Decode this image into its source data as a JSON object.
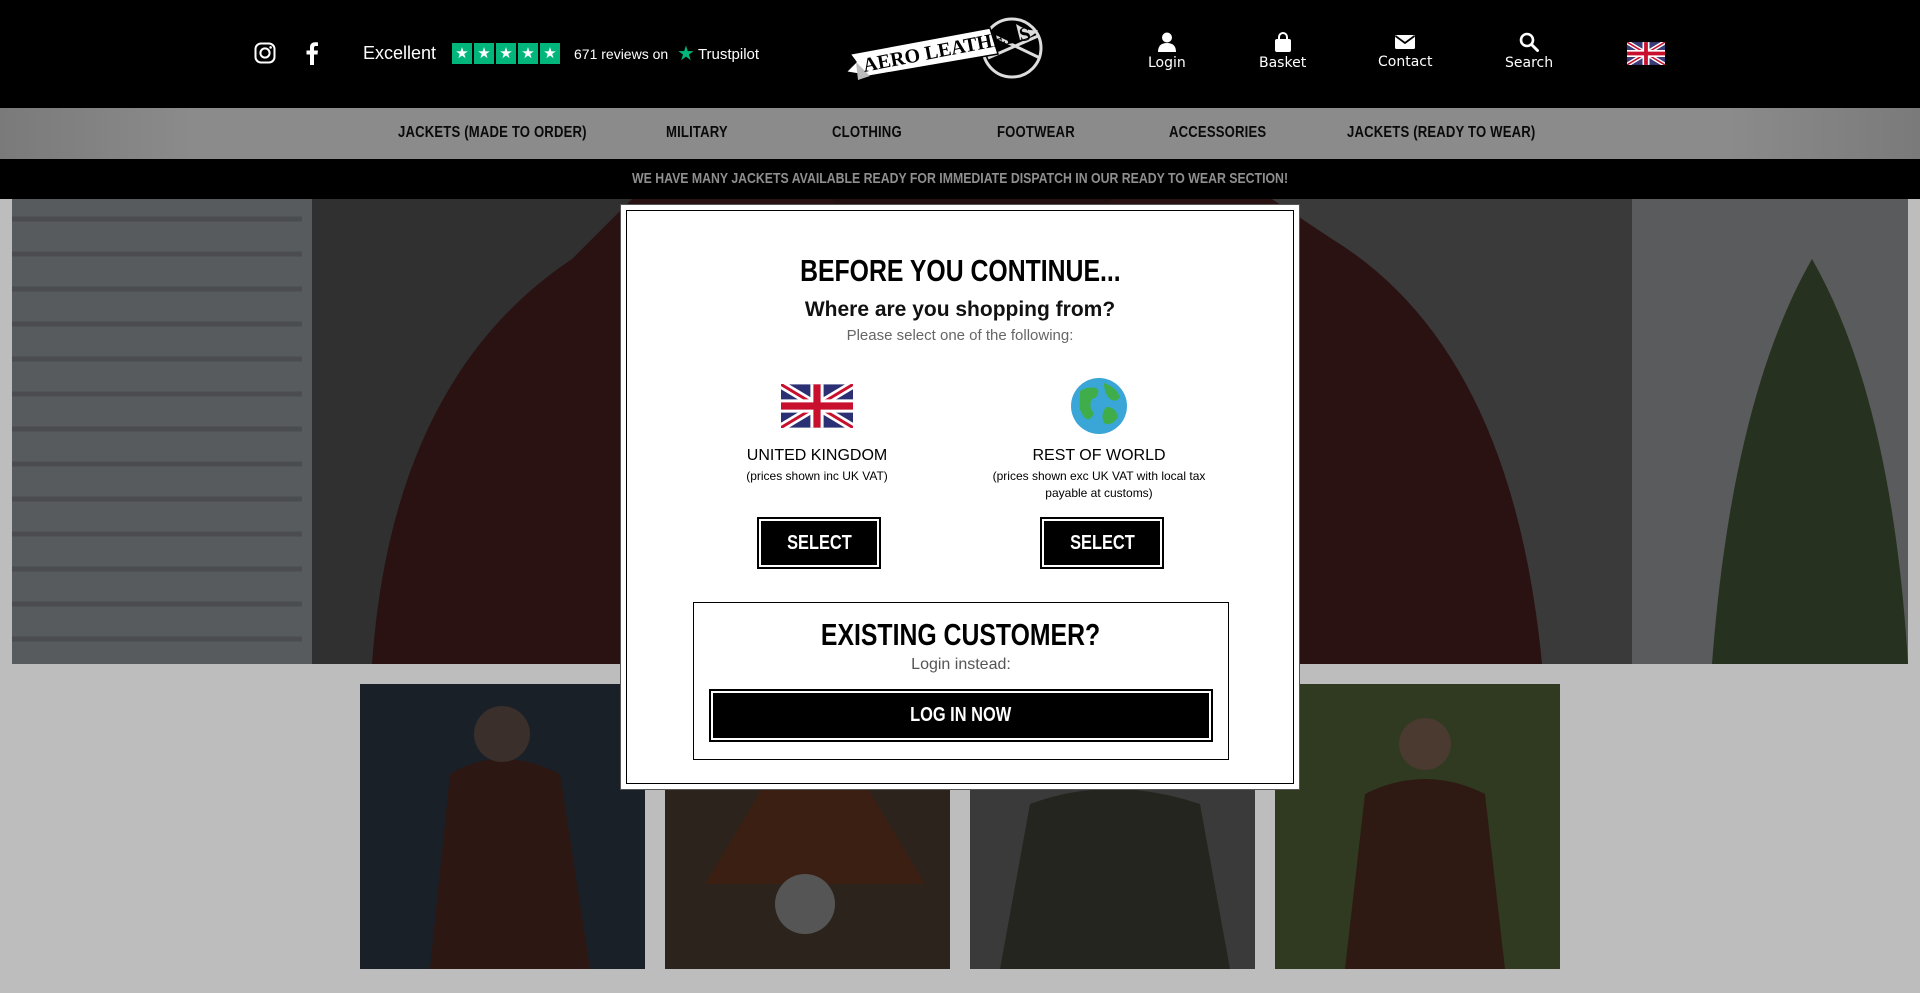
{
  "header": {
    "trustpilot": {
      "rating_label": "Excellent",
      "stars": 5,
      "reviews": "671 reviews on",
      "brand": "Trustpilot"
    },
    "logo_text": "AERO LEATHERS",
    "login_label": "Login",
    "basket_label": "Basket",
    "contact_label": "Contact",
    "search_label": "Search",
    "icons": [
      "instagram-icon",
      "facebook-icon",
      "user-icon",
      "bag-icon",
      "envelope-icon",
      "search-icon",
      "uk-flag-icon"
    ]
  },
  "nav": {
    "items": [
      "JACKETS (MADE TO ORDER)",
      "MILITARY",
      "CLOTHING",
      "FOOTWEAR",
      "ACCESSORIES",
      "JACKETS (READY TO WEAR)"
    ]
  },
  "announcement": "WE HAVE MANY JACKETS AVAILABLE READY FOR IMMEDIATE DISPATCH IN OUR READY TO WEAR SECTION!",
  "modal": {
    "title": "BEFORE YOU CONTINUE...",
    "subtitle": "Where are you shopping from?",
    "instruction": "Please select one of the following:",
    "regions": [
      {
        "name": "UNITED KINGDOM",
        "note": "(prices shown inc UK VAT)",
        "button": "SELECT",
        "icon": "uk-flag-icon"
      },
      {
        "name": "REST OF WORLD",
        "note": "(prices shown exc UK VAT with local tax payable at customs)",
        "button": "SELECT",
        "icon": "globe-icon"
      }
    ],
    "existing": {
      "title": "EXISTING CUSTOMER?",
      "subtitle": "Login instead:",
      "button": "LOG IN NOW"
    }
  },
  "colors": {
    "header_bg": "#000000",
    "trustpilot_green": "#00b67a",
    "nav_bg": "#8b8b8b",
    "modal_bg": "#ffffff",
    "button_bg": "#000000"
  }
}
